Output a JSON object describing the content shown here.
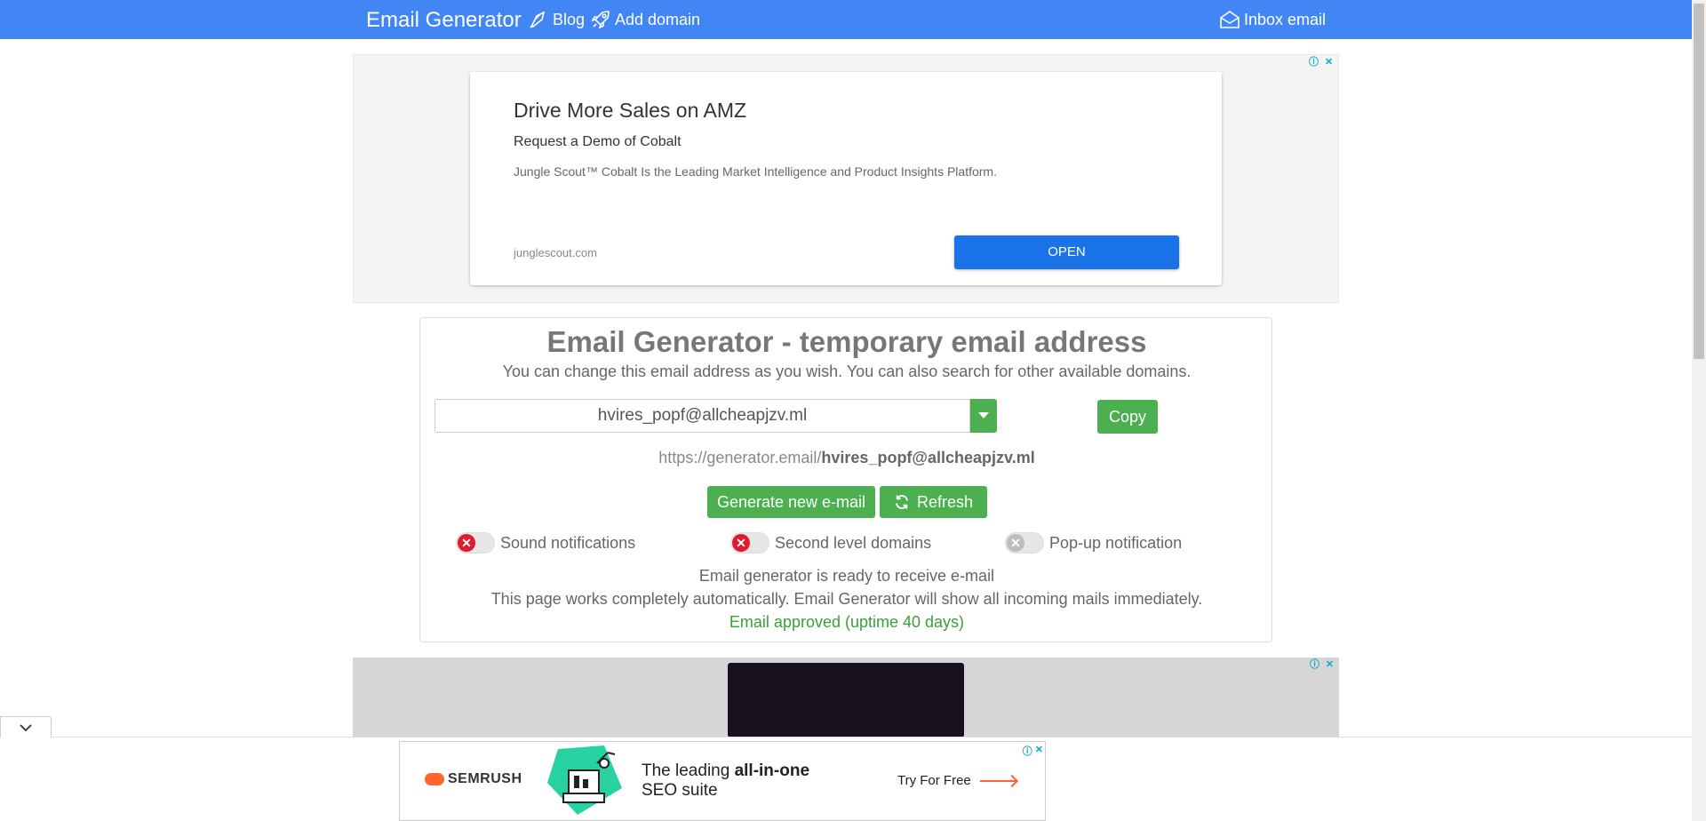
{
  "nav": {
    "brand": "Email Generator",
    "blog": "Blog",
    "add_domain": "Add domain",
    "inbox": "Inbox email"
  },
  "ad_top": {
    "title": "Drive More Sales on AMZ",
    "subtitle": "Request a Demo of Cobalt",
    "description": "Jungle Scout™ Cobalt Is the Leading Market Intelligence and Product Insights Platform.",
    "domain": "junglescout.com",
    "button": "OPEN",
    "info_icon": "ⓘ",
    "close_icon": "✕"
  },
  "generator": {
    "title": "Email Generator - temporary email address",
    "subtitle": "You can change this email address as you wish. You can also search for other available domains.",
    "email_value": "hvires_popf@allcheapjzv.ml",
    "copy_label": "Copy",
    "url_prefix": "https://generator.email/",
    "url_email": "hvires_popf@allcheapjzv.ml",
    "generate_label": "Generate new e-mail",
    "refresh_label": "Refresh",
    "toggles": [
      {
        "label": "Sound notifications",
        "state": "off"
      },
      {
        "label": "Second level domains",
        "state": "off"
      },
      {
        "label": "Pop-up notification",
        "state": "disabled"
      }
    ],
    "status_ready": "Email generator is ready to receive e-mail",
    "status_auto": "This page works completely automatically. Email Generator will show all incoming mails immediately.",
    "status_approved": "Email approved (uptime 40 days)"
  },
  "ad_bottom": {
    "brand": "SEMRUSH",
    "line1_normal": "The leading ",
    "line1_bold": "all-in-one",
    "line2": "SEO suite",
    "cta": "Try For Free"
  },
  "colors": {
    "nav": "#4285f4",
    "green": "#4caf50",
    "approved": "#37a13a",
    "toggle_off": "#e11a2c"
  }
}
